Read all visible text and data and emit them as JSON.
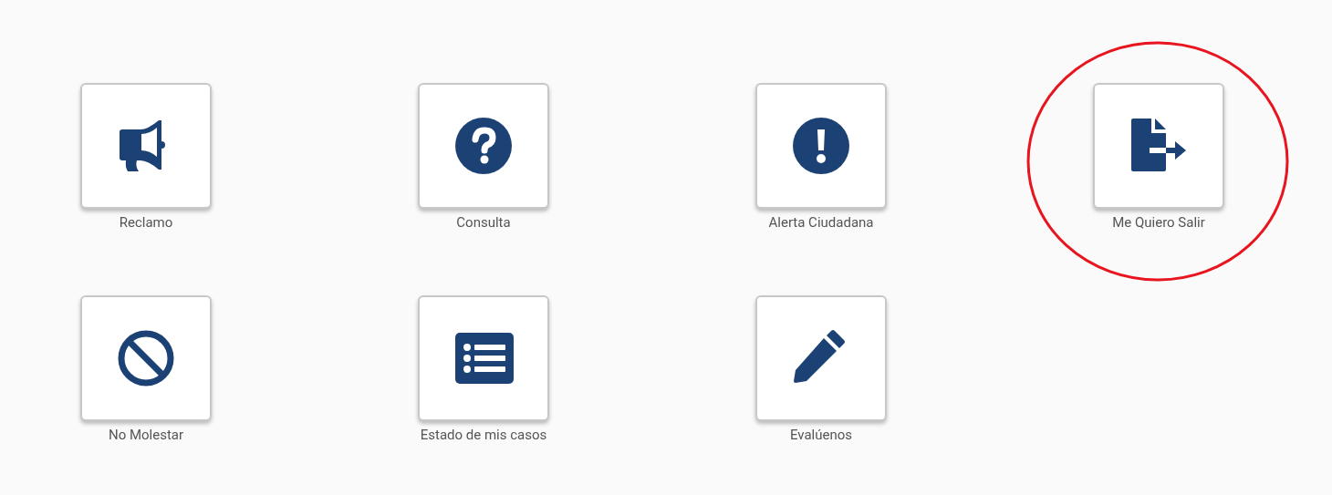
{
  "tiles": [
    {
      "label": "Reclamo",
      "kind": "megaphone",
      "highlighted": false
    },
    {
      "label": "Consulta",
      "kind": "question",
      "highlighted": false
    },
    {
      "label": "Alerta Ciudadana",
      "kind": "alert",
      "highlighted": false
    },
    {
      "label": "Me Quiero Salir",
      "kind": "exit",
      "highlighted": true
    },
    {
      "label": "No Molestar",
      "kind": "ban",
      "highlighted": false
    },
    {
      "label": "Estado de mis casos",
      "kind": "list",
      "highlighted": false
    },
    {
      "label": "Evalúenos",
      "kind": "pencil",
      "highlighted": false
    }
  ]
}
